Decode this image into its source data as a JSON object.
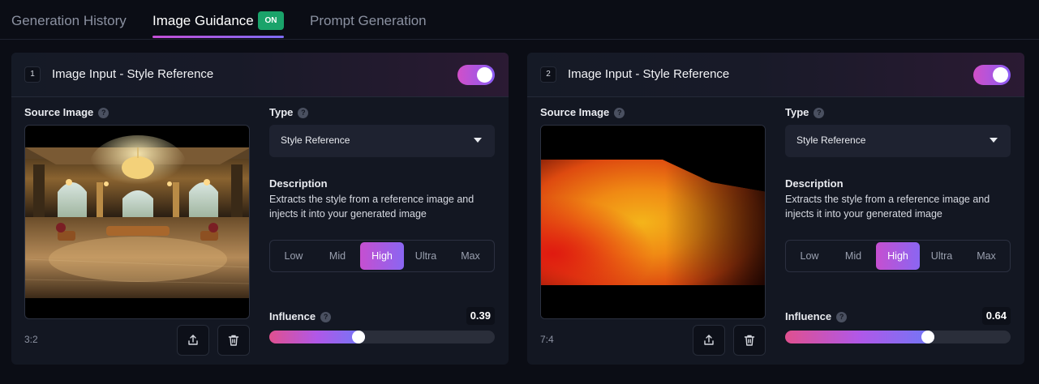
{
  "tabs": {
    "history": "Generation History",
    "guidance": "Image Guidance",
    "guidance_badge": "ON",
    "prompt": "Prompt Generation"
  },
  "cards": [
    {
      "number": "1",
      "title": "Image Input - Style Reference",
      "enabled": true,
      "source_label": "Source Image",
      "aspect_ratio": "3:2",
      "type_label": "Type",
      "type_value": "Style Reference",
      "description_label": "Description",
      "description_text": "Extracts the style from a reference image and injects it into your generated image",
      "strength_options": [
        "Low",
        "Mid",
        "High",
        "Ultra",
        "Max"
      ],
      "strength_selected": "High",
      "influence_label": "Influence",
      "influence_value": "0.39",
      "influence_fraction": 0.39
    },
    {
      "number": "2",
      "title": "Image Input - Style Reference",
      "enabled": true,
      "source_label": "Source Image",
      "aspect_ratio": "7:4",
      "type_label": "Type",
      "type_value": "Style Reference",
      "description_label": "Description",
      "description_text": "Extracts the style from a reference image and injects it into your generated image",
      "strength_options": [
        "Low",
        "Mid",
        "High",
        "Ultra",
        "Max"
      ],
      "strength_selected": "High",
      "influence_label": "Influence",
      "influence_value": "0.64",
      "influence_fraction": 0.64
    }
  ],
  "help_glyph": "?",
  "icons": {
    "upload": "upload-icon",
    "delete": "trash-icon",
    "dropdown": "caret-down-icon"
  },
  "colors": {
    "accent_start": "#d14fc8",
    "accent_end": "#8a5cf5",
    "badge_green": "#1aa36a",
    "background": "#0b0d15",
    "card": "#131722"
  }
}
